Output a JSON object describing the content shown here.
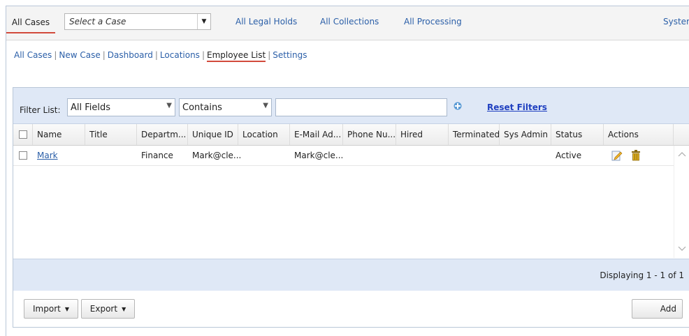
{
  "topnav": {
    "all_cases": "All Cases",
    "select_case_placeholder": "Select a Case",
    "links": [
      "All Legal Holds",
      "All Collections",
      "All Processing",
      "Syster"
    ]
  },
  "subnav": {
    "items": [
      "All Cases",
      "New Case",
      "Dashboard",
      "Locations",
      "Employee List",
      "Settings"
    ],
    "active": "Employee List"
  },
  "filter": {
    "label": "Filter List:",
    "field": "All Fields",
    "operator": "Contains",
    "value": "",
    "reset": "Reset Filters"
  },
  "grid": {
    "columns": [
      "Name",
      "Title",
      "Departm...",
      "Unique ID",
      "Location",
      "E-Mail Ad...",
      "Phone Nu...",
      "Hired",
      "Terminated",
      "Sys Admin",
      "Status",
      "Actions"
    ],
    "rows": [
      {
        "name": "Mark",
        "title": "",
        "department": "Finance",
        "unique_id": "Mark@cle...",
        "location": "",
        "email": "Mark@cle...",
        "phone": "",
        "hired": "",
        "terminated": "",
        "sys_admin": "",
        "status": "Active"
      }
    ]
  },
  "footer": {
    "displaying": "Displaying 1 - 1 of 1"
  },
  "buttons": {
    "import": "Import",
    "export": "Export",
    "add": "Add"
  }
}
